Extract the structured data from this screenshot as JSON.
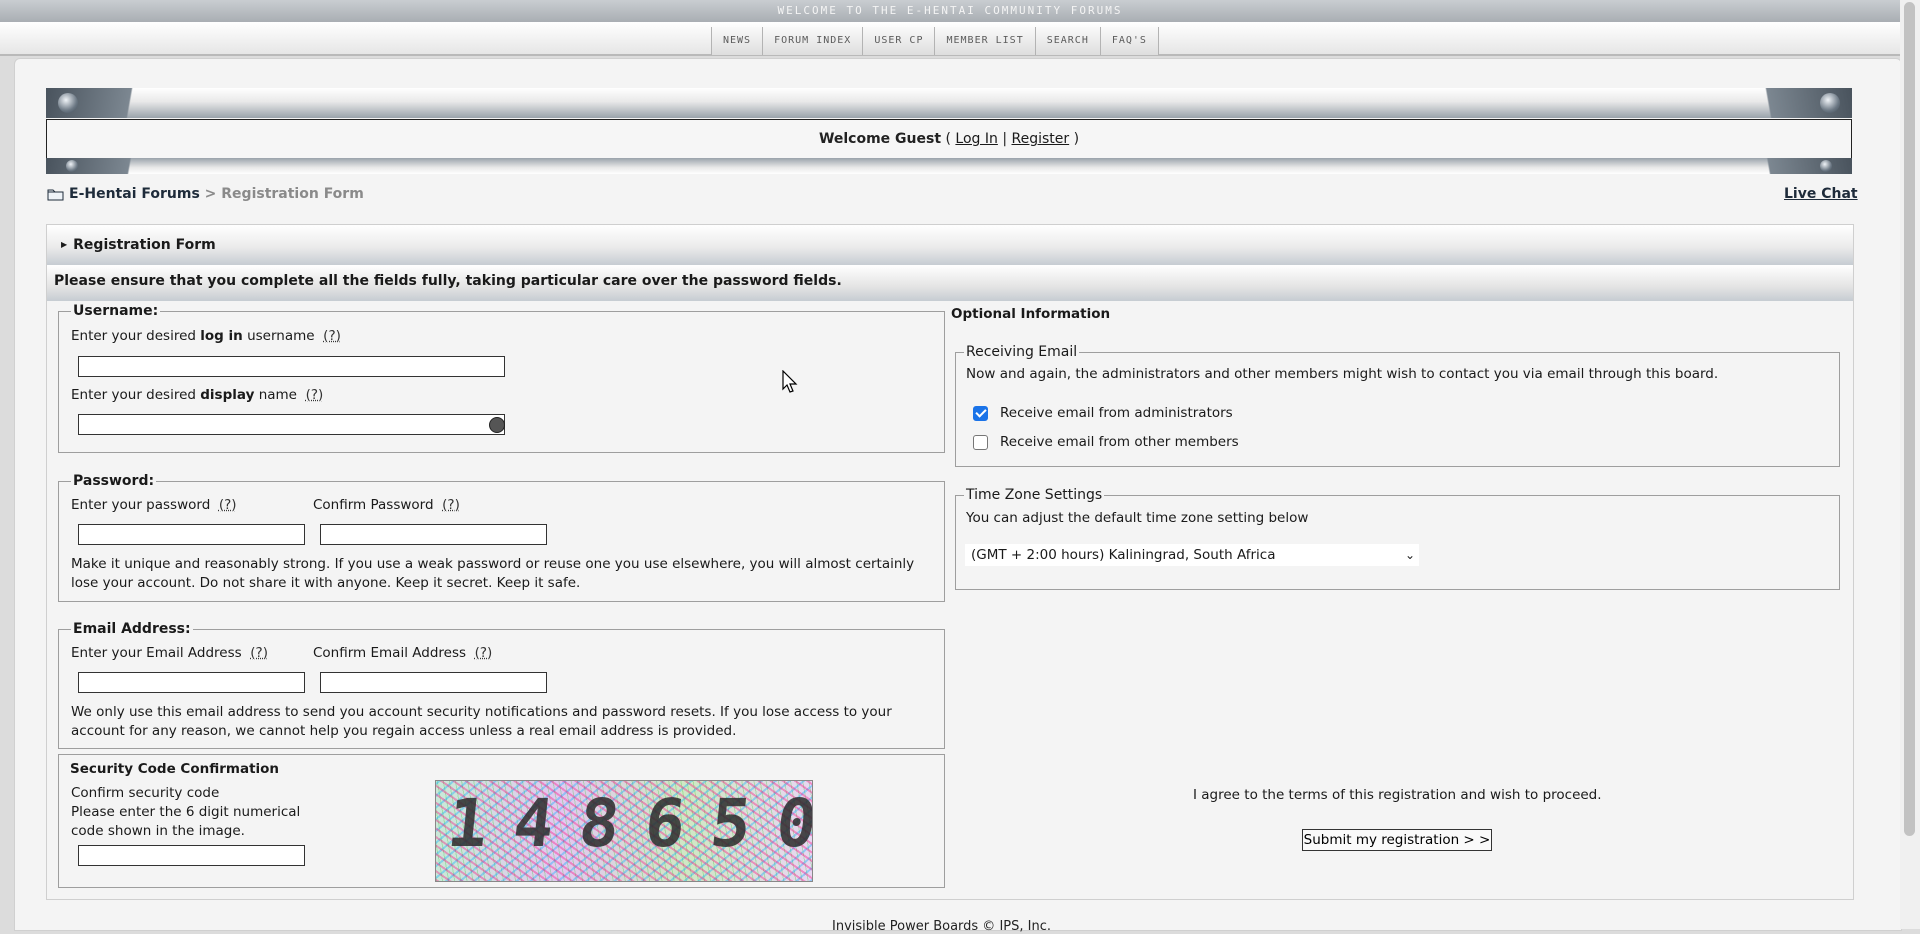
{
  "banner": {
    "text": "WELCOME TO THE E-HENTAI COMMUNITY FORUMS"
  },
  "nav": [
    "NEWS",
    "FORUM INDEX",
    "USER CP",
    "MEMBER LIST",
    "SEARCH",
    "FAQ'S"
  ],
  "userbar": {
    "welcome": "Welcome Guest",
    "open": "(",
    "login": "Log In",
    "sep": "|",
    "register": "Register",
    "close": ")"
  },
  "breadcrumb": {
    "forum": "E-Hentai Forums",
    "sep": ">",
    "current": "Registration Form"
  },
  "livechat": "Live Chat",
  "form": {
    "title": "Registration Form",
    "notice": "Please ensure that you complete all the fields fully, taking particular care over the password fields.",
    "help_marker": "(?)",
    "username": {
      "legend": "Username:",
      "login_pre": "Enter your desired",
      "login_bold": "log in",
      "login_post": "username",
      "display_pre": "Enter your desired",
      "display_bold": "display",
      "display_post": "name"
    },
    "password": {
      "legend": "Password:",
      "enter": "Enter your password",
      "confirm": "Confirm Password",
      "help": "Make it unique and reasonably strong. If you use a weak password or reuse one you use elsewhere, you will almost certainly lose your account. Do not share it with anyone. Keep it secret. Keep it safe."
    },
    "email": {
      "legend": "Email Address:",
      "enter": "Enter your Email Address",
      "confirm": "Confirm Email Address",
      "help": "We only use this email address to send you account security notifications and password resets. If you lose access to your account for any reason, we cannot help you regain access unless a real email address is provided."
    },
    "security": {
      "legend": "Security Code Confirmation",
      "line1": "Confirm security code",
      "line2": "Please enter the 6 digit numerical",
      "line3": "code shown in the image.",
      "captcha_text": "148650"
    },
    "optional": {
      "heading": "Optional Information",
      "receiving_legend": "Receiving Email",
      "receiving_text": "Now and again, the administrators and other members might wish to contact you via email through this board.",
      "admin_label": "Receive email from administrators",
      "admin_checked": true,
      "members_label": "Receive email from other members",
      "members_checked": false,
      "timezone_legend": "Time Zone Settings",
      "timezone_text": "You can adjust the default time zone setting below",
      "timezone_value": "(GMT + 2:00 hours) Kaliningrad, South Africa"
    },
    "agree": "I agree to the terms of this registration and wish to proceed.",
    "submit": "Submit my registration > >"
  },
  "footer": "Invisible Power Boards © IPS, Inc."
}
